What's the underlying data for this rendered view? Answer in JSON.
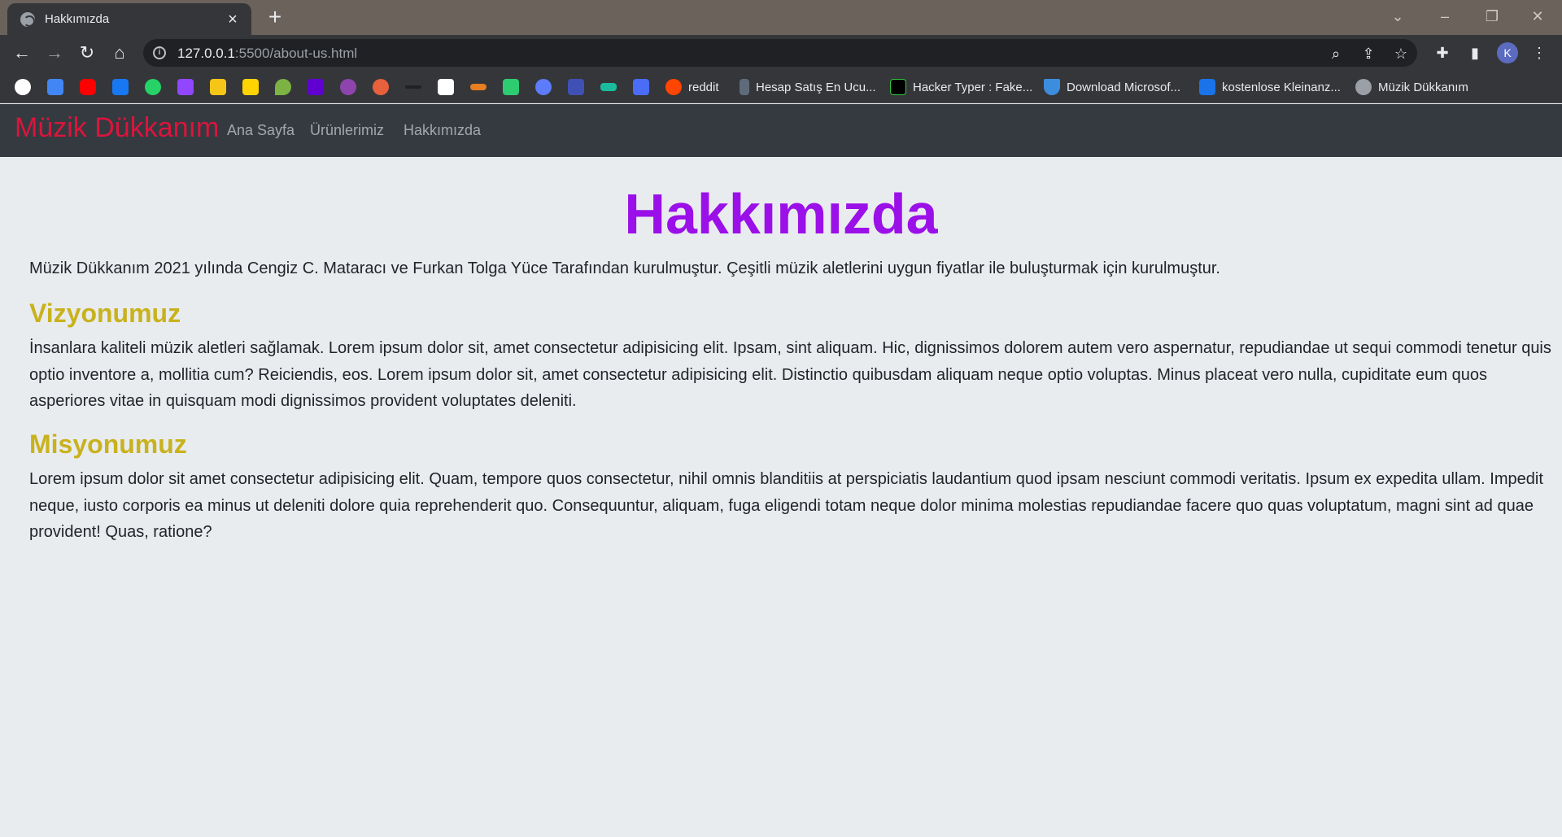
{
  "browser": {
    "tab_title": "Hakkımızda",
    "url_host": "127.0.0.1",
    "url_path": ":5500/about-us.html",
    "avatar_letter": "K",
    "bookmarks": [
      {
        "label": "reddit",
        "icon": "reddit-icon",
        "color": "#ff4500"
      },
      {
        "label": "Hesap Satış En Ucu...",
        "icon": "bookmark-site-icon",
        "color": "#5f6b7a"
      },
      {
        "label": "Hacker Typer : Fake...",
        "icon": "hacker-typer-icon",
        "color": "#000000"
      },
      {
        "label": "Download Microsof...",
        "icon": "download-icon",
        "color": "#3c8dde"
      },
      {
        "label": "kostenlose Kleinanz...",
        "icon": "quoka-icon",
        "color": "#1a73e8"
      },
      {
        "label": "Müzik Dükkanım",
        "icon": "globe-icon",
        "color": "#9aa0a6"
      }
    ]
  },
  "site": {
    "brand": "Müzik Dükkanım",
    "nav": [
      "Ana Sayfa",
      "Ürünlerimiz",
      "Hakkımızda"
    ],
    "colors": {
      "brand": "#dc143c",
      "title": "#9b10e8",
      "section": "#c8b21d",
      "navbar": "#343a40",
      "background": "#e9ecef"
    }
  },
  "page": {
    "title": "Hakkımızda",
    "intro": "Müzik Dükkanım 2021 yılında Cengiz C. Mataracı ve Furkan Tolga Yüce Tarafından kurulmuştur. Çeşitli müzik aletlerini uygun fiyatlar ile buluşturmak için kurulmuştur.",
    "vision_title": "Vizyonumuz",
    "vision_text": "İnsanlara kaliteli müzik aletleri sağlamak. Lorem ipsum dolor sit, amet consectetur adipisicing elit. Ipsam, sint aliquam. Hic, dignissimos dolorem autem vero aspernatur, repudiandae ut sequi commodi tenetur quis optio inventore a, mollitia cum? Reiciendis, eos. Lorem ipsum dolor sit, amet consectetur adipisicing elit. Distinctio quibusdam aliquam neque optio voluptas. Minus placeat vero nulla, cupiditate eum quos asperiores vitae in quisquam modi dignissimos provident voluptates deleniti.",
    "mission_title": "Misyonumuz",
    "mission_text": "Lorem ipsum dolor sit amet consectetur adipisicing elit. Quam, tempore quos consectetur, nihil omnis blanditiis at perspiciatis laudantium quod ipsam nesciunt commodi veritatis. Ipsum ex expedita ullam. Impedit neque, iusto corporis ea minus ut deleniti dolore quia reprehenderit quo. Consequuntur, aliquam, fuga eligendi totam neque dolor minima molestias repudiandae facere quo quas voluptatum, magni sint ad quae provident! Quas, ratione?"
  }
}
